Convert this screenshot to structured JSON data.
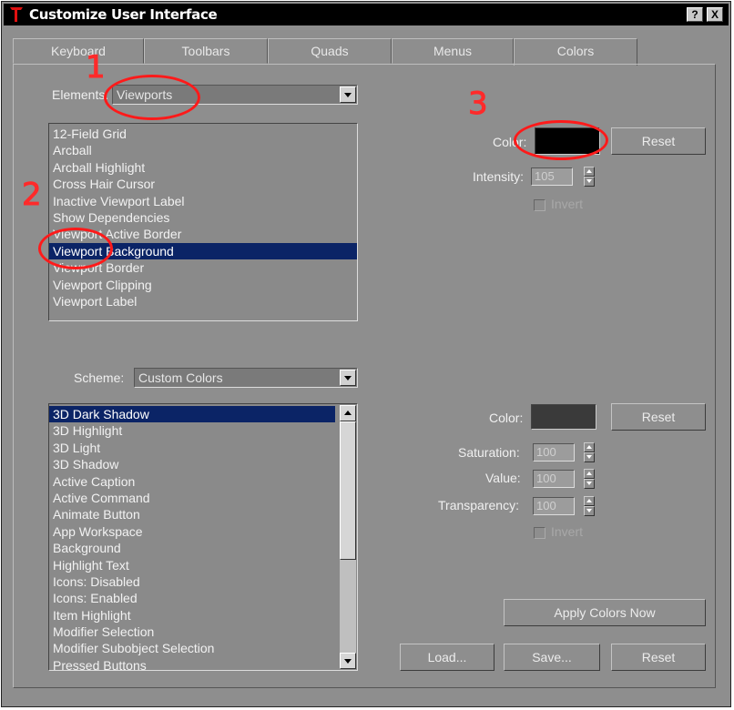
{
  "window": {
    "title": "Customize User Interface",
    "help_btn": "?",
    "close_btn": "X"
  },
  "tabs": [
    "Keyboard",
    "Toolbars",
    "Quads",
    "Menus",
    "Colors"
  ],
  "elements": {
    "label": "Elements:",
    "selected": "Viewports",
    "items": [
      "12-Field Grid",
      "Arcball",
      "Arcball Highlight",
      "Cross Hair Cursor",
      "Inactive Viewport Label",
      "Show Dependencies",
      "Viewport Active Border",
      "Viewport Background",
      "Viewport Border",
      "Viewport Clipping",
      "Viewport Label"
    ],
    "selected_item": "Viewport Background"
  },
  "element_color": {
    "label": "Color:",
    "swatch_color": "#000000",
    "reset": "Reset",
    "intensity_label": "Intensity:",
    "intensity_value": "105",
    "invert_label": "Invert"
  },
  "scheme": {
    "label": "Scheme:",
    "selected": "Custom Colors",
    "items": [
      "3D Dark Shadow",
      "3D Highlight",
      "3D Light",
      "3D Shadow",
      "Active Caption",
      "Active Command",
      "Animate Button",
      "App Workspace",
      "Background",
      "Highlight Text",
      "Icons: Disabled",
      "Icons: Enabled",
      "Item Highlight",
      "Modifier Selection",
      "Modifier Subobject Selection",
      "Pressed Buttons"
    ],
    "selected_item": "3D Dark Shadow"
  },
  "scheme_color": {
    "label": "Color:",
    "swatch_color": "#3a3a3a",
    "reset": "Reset",
    "saturation_label": "Saturation:",
    "saturation_value": "100",
    "value_label": "Value:",
    "value_value": "100",
    "transparency_label": "Transparency:",
    "transparency_value": "100",
    "invert_label": "Invert"
  },
  "buttons": {
    "apply": "Apply Colors Now",
    "load": "Load...",
    "save": "Save...",
    "reset": "Reset"
  },
  "annotations": [
    "1",
    "2",
    "3"
  ],
  "colors": {
    "annotation": "#ff1a1a",
    "selection": "#0b2466",
    "panel": "#8e8e8e"
  }
}
